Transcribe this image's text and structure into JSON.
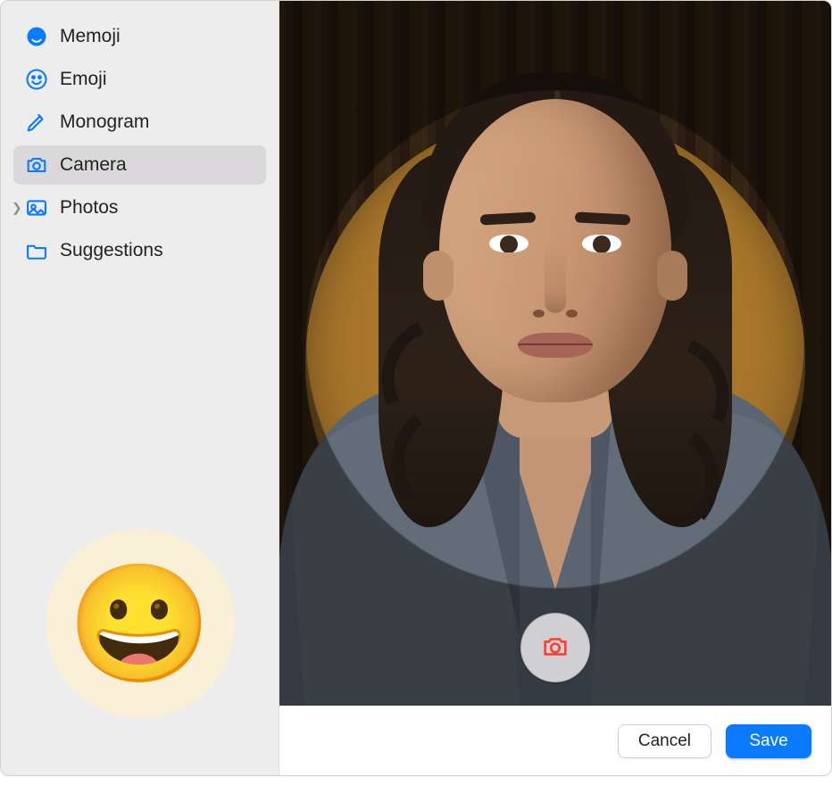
{
  "sidebar": {
    "items": [
      {
        "label": "Memoji",
        "icon": "memoji-face-icon"
      },
      {
        "label": "Emoji",
        "icon": "emoji-smile-icon"
      },
      {
        "label": "Monogram",
        "icon": "pencil-icon"
      },
      {
        "label": "Camera",
        "icon": "camera-icon"
      },
      {
        "label": "Photos",
        "icon": "photos-icon",
        "expandable": true
      },
      {
        "label": "Suggestions",
        "icon": "folder-icon"
      }
    ],
    "selected": "Camera",
    "current_avatar_emoji": "😀"
  },
  "footer": {
    "cancel_label": "Cancel",
    "save_label": "Save"
  }
}
